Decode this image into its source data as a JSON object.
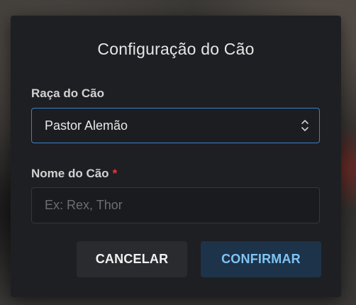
{
  "dialog": {
    "title": "Configuração do Cão",
    "breed": {
      "label": "Raça do Cão",
      "selected": "Pastor Alemão",
      "icon": "chevron-updown-icon"
    },
    "name": {
      "label": "Nome do Cão",
      "required_marker": "*",
      "value": "",
      "placeholder": "Ex: Rex, Thor"
    },
    "buttons": {
      "cancel": "CANCELAR",
      "confirm": "CONFIRMAR"
    }
  },
  "colors": {
    "dialog_bg": "#1e1f23",
    "focus_border": "#3d7fc8",
    "required": "#e53935",
    "confirm_bg": "#1d3349",
    "confirm_text": "#7fc4f4",
    "cancel_bg": "#2a2b2f"
  }
}
